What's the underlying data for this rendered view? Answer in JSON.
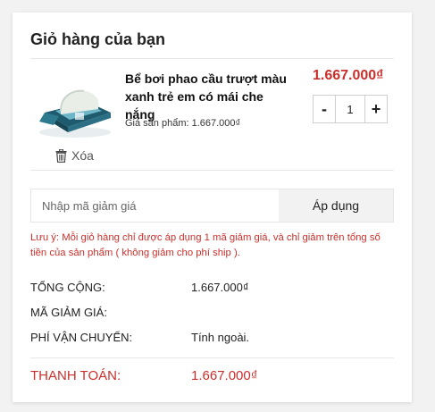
{
  "cart": {
    "title": "Giỏ hàng của bạn",
    "item": {
      "name": "Bể bơi phao cầu trượt màu xanh trẻ em có mái che nắng",
      "unit_price_text": "Giá sản phẩm: 1.667.000₫",
      "line_price": "1.667.000₫",
      "quantity": "1",
      "minus_label": "-",
      "plus_label": "+",
      "remove_label": "Xóa",
      "remove_icon": "trash-icon",
      "image_icon": "product-thumbnail"
    },
    "coupon": {
      "placeholder": "Nhập mã giảm giá",
      "apply_label": "Áp dụng",
      "note": "Lưu ý: Mỗi giỏ hàng chỉ được áp dụng 1 mã giảm giá, và chỉ giảm trên tổng số tiền của sản phẩm ( không giảm cho phí ship )."
    },
    "summary": {
      "subtotal_label": "TỔNG CỘNG:",
      "subtotal_value": "1.667.000₫",
      "discount_label": "MÃ GIẢM GIÁ:",
      "discount_value": "",
      "shipping_label": "PHÍ VẬN CHUYỂN:",
      "shipping_value": "Tính ngoài.",
      "total_label": "THANH TOÁN:",
      "total_value": "1.667.000₫"
    },
    "colors": {
      "accent": "#c9302c",
      "button_bg": "#f2f2f2"
    }
  }
}
